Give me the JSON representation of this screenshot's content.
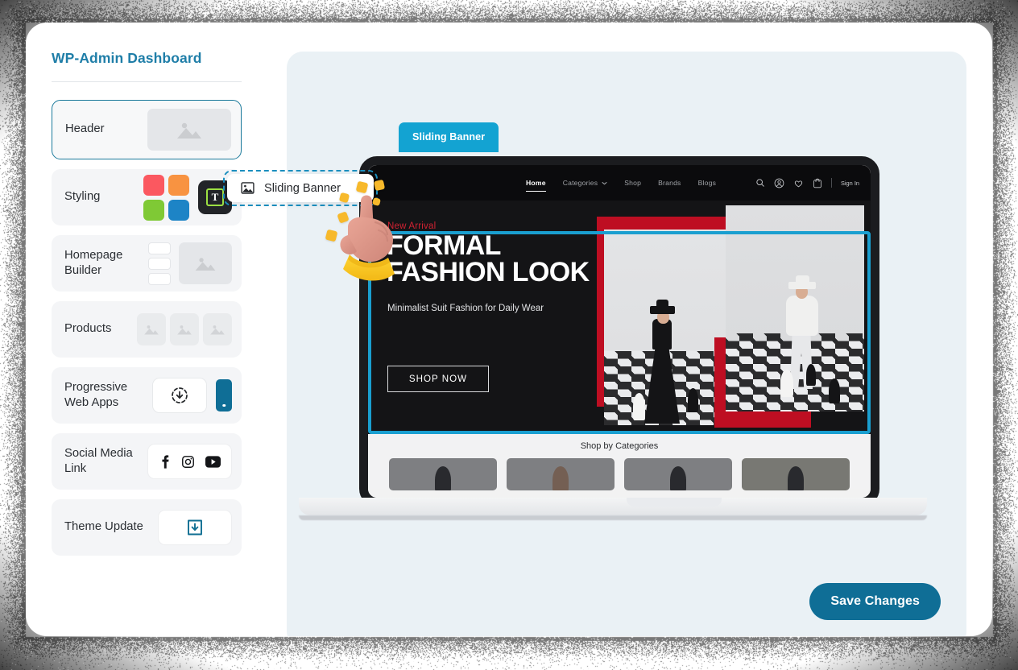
{
  "sidebar": {
    "title": "WP-Admin Dashboard",
    "items": [
      {
        "label": "Header",
        "icon": "image-placeholder-icon",
        "selected": true
      },
      {
        "label": "Styling",
        "icon": "color-swatches-icon",
        "selected": false
      },
      {
        "label": "Homepage Builder",
        "icon": "layout-blocks-icon",
        "selected": false
      },
      {
        "label": "Products",
        "icon": "product-thumbnails-icon",
        "selected": false
      },
      {
        "label": "Progressive Web Apps",
        "icon": "install-app-icon",
        "selected": false
      },
      {
        "label": "Social Media Link",
        "icon": "social-icons",
        "selected": false
      },
      {
        "label": "Theme Update",
        "icon": "download-box-icon",
        "selected": false
      }
    ],
    "styling_swatches": [
      "#FB5860",
      "#F89341",
      "#7FC935",
      "#1D84C6"
    ],
    "text_tool_glyph": "T"
  },
  "drag_chip": {
    "label": "Sliding Banner",
    "icon": "image-placeholder-icon"
  },
  "preview": {
    "tab_badge": "Sliding Banner",
    "site": {
      "nav": [
        {
          "label": "Home",
          "active": true,
          "has_caret": false
        },
        {
          "label": "Categories",
          "active": false,
          "has_caret": true
        },
        {
          "label": "Shop",
          "active": false,
          "has_caret": false
        },
        {
          "label": "Brands",
          "active": false,
          "has_caret": false
        },
        {
          "label": "Blogs",
          "active": false,
          "has_caret": false
        }
      ],
      "actions": [
        "search-icon",
        "user-icon",
        "heart-icon",
        "bag-icon"
      ],
      "sign_in": "Sign In"
    },
    "hero": {
      "eyebrow": "New Arrival",
      "title_line1": "FORMAL",
      "title_line2": "FASHION LOOK",
      "subtitle": "Minimalist Suit Fashion for Daily Wear",
      "cta": "SHOP NOW"
    },
    "categories_section": {
      "title": "Shop by Categories",
      "cells": 4
    }
  },
  "actions": {
    "save_label": "Save Changes"
  },
  "colors": {
    "brand_teal": "#0F6E96",
    "accent_cyan": "#13A3D2",
    "panel_bg": "#EAF1F5",
    "hero_red": "#BE0E22",
    "selected_border": "#1B7A9B"
  }
}
